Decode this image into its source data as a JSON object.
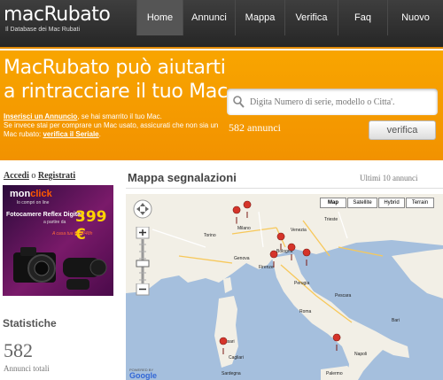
{
  "header": {
    "logo_name": "macRubato",
    "logo_sub": "Il Database dei Mac Rubati",
    "nav": [
      {
        "label": "Home",
        "active": true
      },
      {
        "label": "Annunci"
      },
      {
        "label": "Mappa"
      },
      {
        "label": "Verifica"
      },
      {
        "label": "Faq"
      },
      {
        "label": "Nuovo"
      }
    ]
  },
  "hero": {
    "title_line1": "MacRubato può aiutarti",
    "title_line2": "a rintracciare il tuo Mac.",
    "desc_link1": "Inserisci un Annuncio",
    "desc_text1": ", se hai smarrito il tuo Mac.",
    "desc_text2": "Se invece stai per comprare un Mac usato, assicurati che non sia un Mac rubato: ",
    "desc_link2": "verifica il Seriale",
    "desc_end": ".",
    "search_placeholder": "Digita Numero di serie, modello o Citta'.",
    "count": "582 annunci",
    "verify_button": "verifica"
  },
  "sidebar": {
    "login": "Accedi",
    "sep": " o ",
    "register": "Registrati",
    "ad": {
      "brand_a": "mon",
      "brand_b": "click",
      "tagline": "lo compri on line",
      "product": "Fotocamere Reflex Digitali",
      "from": "a partire da",
      "price": "399 €",
      "home": "A casa tua in 24/48h"
    },
    "stats_title": "Statistiche",
    "stats_count": "582",
    "stats_label": "Annunci totali"
  },
  "map": {
    "title": "Mappa segnalazioni",
    "subtitle": "Ultimi 10 annunci",
    "buttons": [
      {
        "label": "Map",
        "active": true
      },
      {
        "label": "Satellite"
      },
      {
        "label": "Hybrid"
      },
      {
        "label": "Terrain"
      }
    ],
    "powered": "POWERED BY",
    "google": "Google",
    "cities": [
      "Milano",
      "Venezia",
      "Bologna",
      "Firenze",
      "Perugia",
      "Roma",
      "Napoli",
      "Sassari",
      "Cagliari",
      "Sardegna",
      "Torino",
      "Genova",
      "Trieste",
      "Pescara",
      "Bari",
      "Palermo"
    ],
    "colors": {
      "sea": "#a5bfdd",
      "land": "#f2efe6",
      "pin": "#d5342a"
    }
  }
}
